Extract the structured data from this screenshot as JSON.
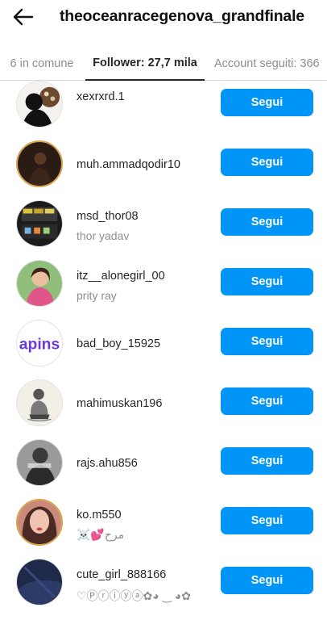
{
  "header": {
    "back_icon": "arrow-left-icon",
    "title": "theoceanracegenova_grandfinale"
  },
  "tabs": [
    {
      "label": "6 in comune",
      "active": false
    },
    {
      "label": "Follower: 27,7 mila",
      "active": true
    },
    {
      "label": "Account seguiti: 366",
      "active": false
    }
  ],
  "accent_color": "#0095f6",
  "followers": [
    {
      "username": "xexrxrd.1",
      "display_name": "",
      "button": "Segui"
    },
    {
      "username": "muh.ammadqodir10",
      "display_name": "",
      "button": "Segui"
    },
    {
      "username": "msd_thor08",
      "display_name": "thor yadav",
      "button": "Segui"
    },
    {
      "username": "itz__alonegirl_00",
      "display_name": "prity ray",
      "button": "Segui"
    },
    {
      "username": "bad_boy_15925",
      "display_name": "",
      "button": "Segui"
    },
    {
      "username": "mahimuskan196",
      "display_name": "",
      "button": "Segui"
    },
    {
      "username": "rajs.ahu856",
      "display_name": "",
      "button": "Segui"
    },
    {
      "username": "ko.m550",
      "display_name": "☠️💕مرح",
      "button": "Segui"
    },
    {
      "username": "cute_girl_888166",
      "display_name": "♡Ⓟⓡⓘⓨⓐ✿◕ ‿ ◕✿",
      "button": "Segui"
    }
  ],
  "avatar_text": {
    "bad_boy_15925": "apins"
  }
}
